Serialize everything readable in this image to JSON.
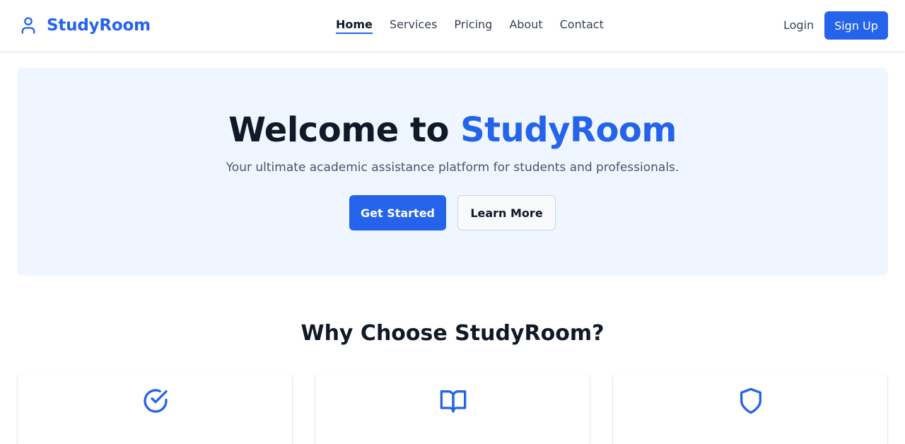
{
  "brand": {
    "name": "StudyRoom",
    "icon": "user-icon",
    "color": "#2563eb"
  },
  "nav": {
    "links": [
      {
        "label": "Home",
        "active": true
      },
      {
        "label": "Services",
        "active": false
      },
      {
        "label": "Pricing",
        "active": false
      },
      {
        "label": "About",
        "active": false
      },
      {
        "label": "Contact",
        "active": false
      }
    ],
    "login_label": "Login",
    "signup_label": "Sign Up"
  },
  "hero": {
    "title_prefix": "Welcome to",
    "title_accent": "StudyRoom",
    "subtitle": "Your ultimate academic assistance platform for students and professionals.",
    "primary_label": "Get Started",
    "secondary_label": "Learn More",
    "background": "#eff6ff"
  },
  "features": {
    "title": "Why Choose StudyRoom?",
    "cards": [
      {
        "icon": "check-circle-icon"
      },
      {
        "icon": "book-open-icon"
      },
      {
        "icon": "shield-icon"
      }
    ]
  },
  "colors": {
    "accent": "#2563eb",
    "text": "#111827",
    "muted": "#4b5563"
  }
}
